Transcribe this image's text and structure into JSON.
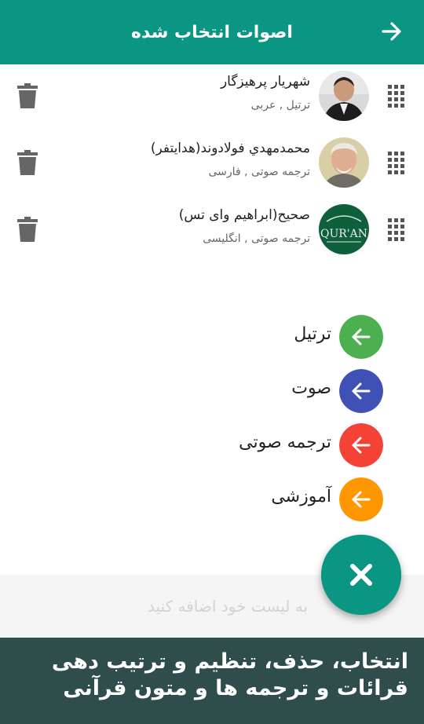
{
  "appbar": {
    "title": "اصوات انتخاب شده"
  },
  "selected": [
    {
      "name": "شهریار پرهیزگار",
      "sub": "ترتیل , عربی"
    },
    {
      "name": "محمدمهدي فولادوند(هدایتفر)",
      "sub": "ترجمه صوتی , فارسی"
    },
    {
      "name": "صحیح(ابراهیم وای تس)",
      "sub": "ترجمه صوتی , انگلیسی",
      "avatar_text": "QUR'AN"
    }
  ],
  "fab_menu": [
    {
      "label": "ترتیل",
      "color": "#4caf50"
    },
    {
      "label": "صوت",
      "color": "#3f51b5"
    },
    {
      "label": "ترجمه صوتی",
      "color": "#f44336"
    },
    {
      "label": "آموزشی",
      "color": "#ff9800"
    }
  ],
  "input": {
    "placeholder": "به لیست خود اضافه کنید"
  },
  "fab_main_color": "#0b9684",
  "banner": {
    "line1": "انتخاب، حذف، تنظیم و ترتیب دهی",
    "line2": "قرائات و ترجمه ها و متون قرآنی"
  }
}
